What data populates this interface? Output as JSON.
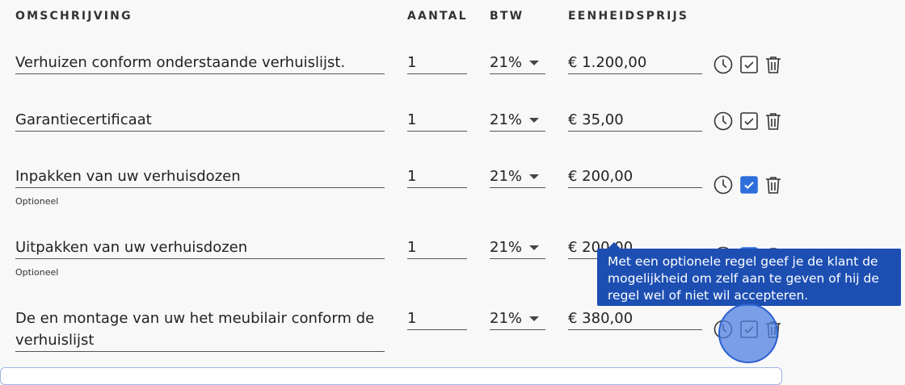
{
  "headers": {
    "description": "OMSCHRIJVING",
    "quantity": "AANTAL",
    "vat": "BTW",
    "unit_price": "EENHEIDSPRIJS"
  },
  "rows": [
    {
      "description": "Verhuizen conform onderstaande verhuislijst.",
      "quantity": "1",
      "vat": "21%",
      "price": "€ 1.200,00",
      "optional_label": "",
      "optional_checked": false
    },
    {
      "description": "Garantiecertificaat",
      "quantity": "1",
      "vat": "21%",
      "price": "€ 35,00",
      "optional_label": "",
      "optional_checked": false
    },
    {
      "description": "Inpakken van uw verhuisdozen",
      "quantity": "1",
      "vat": "21%",
      "price": "€ 200,00",
      "optional_label": "Optioneel",
      "optional_checked": true
    },
    {
      "description": "Uitpakken van uw verhuisdozen",
      "quantity": "1",
      "vat": "21%",
      "price": "€ 200,00",
      "optional_label": "Optioneel",
      "optional_checked": true
    },
    {
      "description": "De en montage van uw het meubilair conform de verhuislijst",
      "quantity": "1",
      "vat": "21%",
      "price": "€ 380,00",
      "optional_label": "",
      "optional_checked": false
    }
  ],
  "tooltip": {
    "text": "Met een optionele regel geef je de klant de mogelijkheid om zelf aan te geven of hij de regel wel of niet wil accepteren."
  },
  "icons": {
    "clock": "clock-icon",
    "optional": "checkbox-icon",
    "delete": "trash-icon"
  },
  "colors": {
    "accent": "#2f6fdc",
    "tooltip_bg": "#1d4fb3",
    "cursor": "#4f82e1"
  }
}
